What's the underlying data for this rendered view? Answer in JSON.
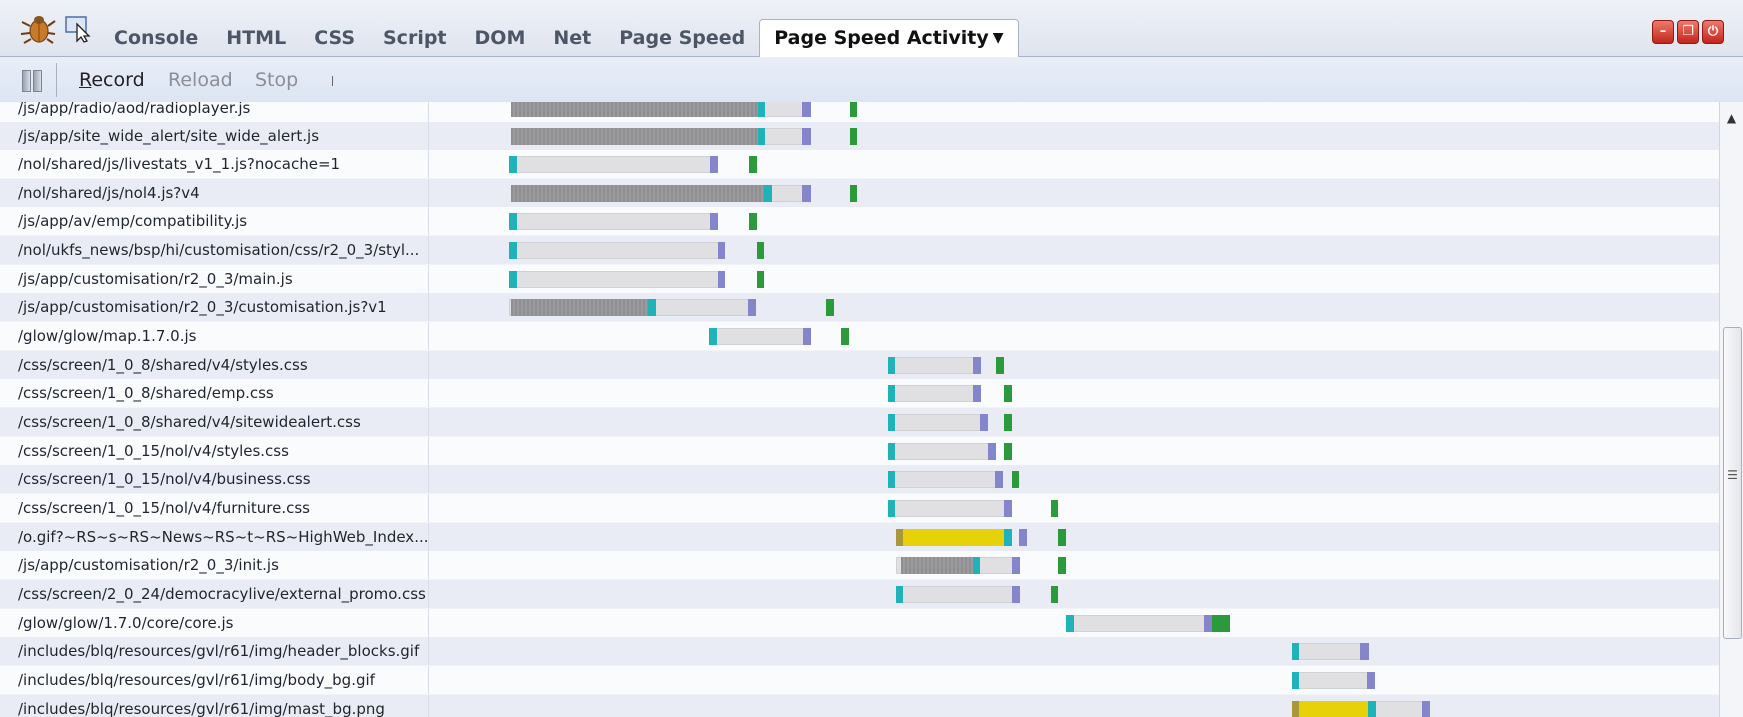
{
  "tabs": [
    {
      "label": "Console"
    },
    {
      "label": "HTML"
    },
    {
      "label": "CSS"
    },
    {
      "label": "Script"
    },
    {
      "label": "DOM"
    },
    {
      "label": "Net"
    },
    {
      "label": "Page Speed"
    },
    {
      "label": "Page Speed Activity",
      "active": true
    }
  ],
  "window_buttons": [
    "minimize-icon",
    "restore-icon",
    "close-icon"
  ],
  "toolbar": {
    "record_label": "Record",
    "reload_label": "Reload",
    "stop_label": "Stop"
  },
  "colors": {
    "tabbar_bg": "#e4e8f1",
    "row_alt_bg": "#e9ecf5",
    "wait": "#e0e0e2",
    "blocking": "#8f8f92",
    "connect": "#1fb2b8",
    "receive": "#8585cc",
    "parse": "#2b9a3a",
    "execute": "#e6d10a",
    "window_button": "#c4241a"
  },
  "resources": [
    {
      "name": "/js/app/radio/aod/radioplayer.js"
    },
    {
      "name": "/js/app/site_wide_alert/site_wide_alert.js"
    },
    {
      "name": "/nol/shared/js/livestats_v1_1.js?nocache=1"
    },
    {
      "name": "/nol/shared/js/nol4.js?v4"
    },
    {
      "name": "/js/app/av/emp/compatibility.js"
    },
    {
      "name": "/nol/ukfs_news/bsp/hi/customisation/css/r2_0_3/styl..."
    },
    {
      "name": "/js/app/customisation/r2_0_3/main.js"
    },
    {
      "name": "/js/app/customisation/r2_0_3/customisation.js?v1"
    },
    {
      "name": "/glow/glow/map.1.7.0.js"
    },
    {
      "name": "/css/screen/1_0_8/shared/v4/styles.css"
    },
    {
      "name": "/css/screen/1_0_8/shared/emp.css"
    },
    {
      "name": "/css/screen/1_0_8/shared/v4/sitewidealert.css"
    },
    {
      "name": "/css/screen/1_0_15/nol/v4/styles.css"
    },
    {
      "name": "/css/screen/1_0_15/nol/v4/business.css"
    },
    {
      "name": "/css/screen/1_0_15/nol/v4/furniture.css"
    },
    {
      "name": "/o.gif?~RS~s~RS~News~RS~t~RS~HighWeb_Index..."
    },
    {
      "name": "/js/app/customisation/r2_0_3/init.js"
    },
    {
      "name": "/css/screen/2_0_24/democracylive/external_promo.css"
    },
    {
      "name": "/glow/glow/1.7.0/core/core.js"
    },
    {
      "name": "/includes/blq/resources/gvl/r61/img/header_blocks.gif"
    },
    {
      "name": "/includes/blq/resources/gvl/r61/img/body_bg.gif"
    },
    {
      "name": "/includes/blq/resources/gvl/r61/img/mast_bg.png"
    }
  ]
}
